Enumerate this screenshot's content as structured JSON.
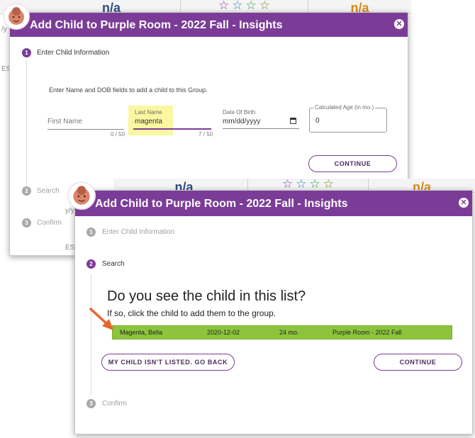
{
  "colors": {
    "header_purple": "#7b3c97",
    "result_green": "#8cc43d",
    "highlight_yellow": "#fbf7a1",
    "arrow_orange": "#e8652a"
  },
  "background": {
    "na_label": "n/a",
    "side_fragments": [
      "/y",
      "ES",
      "y/y",
      "ES"
    ]
  },
  "modal1": {
    "title": "Add Child to Purple Room - 2022 Fall - Insights",
    "steps": [
      {
        "number": "1",
        "label": "Enter Child Information"
      },
      {
        "number": "2",
        "label": "Search"
      },
      {
        "number": "3",
        "label": "Confirm"
      }
    ],
    "instructions": "Enter Name and DOB fields to add a child to this Group.",
    "first_name": {
      "placeholder": "First Name",
      "counter": "0 / 50"
    },
    "last_name": {
      "label": "Last Name",
      "value": "magenta",
      "counter": "7 / 50"
    },
    "dob": {
      "label": "Date Of Birth",
      "placeholder": "mm/dd/yyyy"
    },
    "age": {
      "label": "Calculated Age (in mo.)",
      "value": "0"
    },
    "continue_label": "CONTINUE"
  },
  "modal2": {
    "title": "Add Child to Purple Room - 2022 Fall - Insights",
    "steps": [
      {
        "number": "1",
        "label": "Enter Child Information"
      },
      {
        "number": "2",
        "label": "Search"
      },
      {
        "number": "3",
        "label": "Confirm"
      }
    ],
    "question": "Do you see the child in this list?",
    "subtext": "If so, click the child to add them to the group.",
    "result": {
      "name": "Magenta, Bella",
      "dob": "2020-12-02",
      "age": "24 mo.",
      "room": "Purple Room - 2022 Fall"
    },
    "not_listed_label": "MY CHILD ISN'T LISTED. GO BACK",
    "continue_label": "CONTINUE"
  }
}
